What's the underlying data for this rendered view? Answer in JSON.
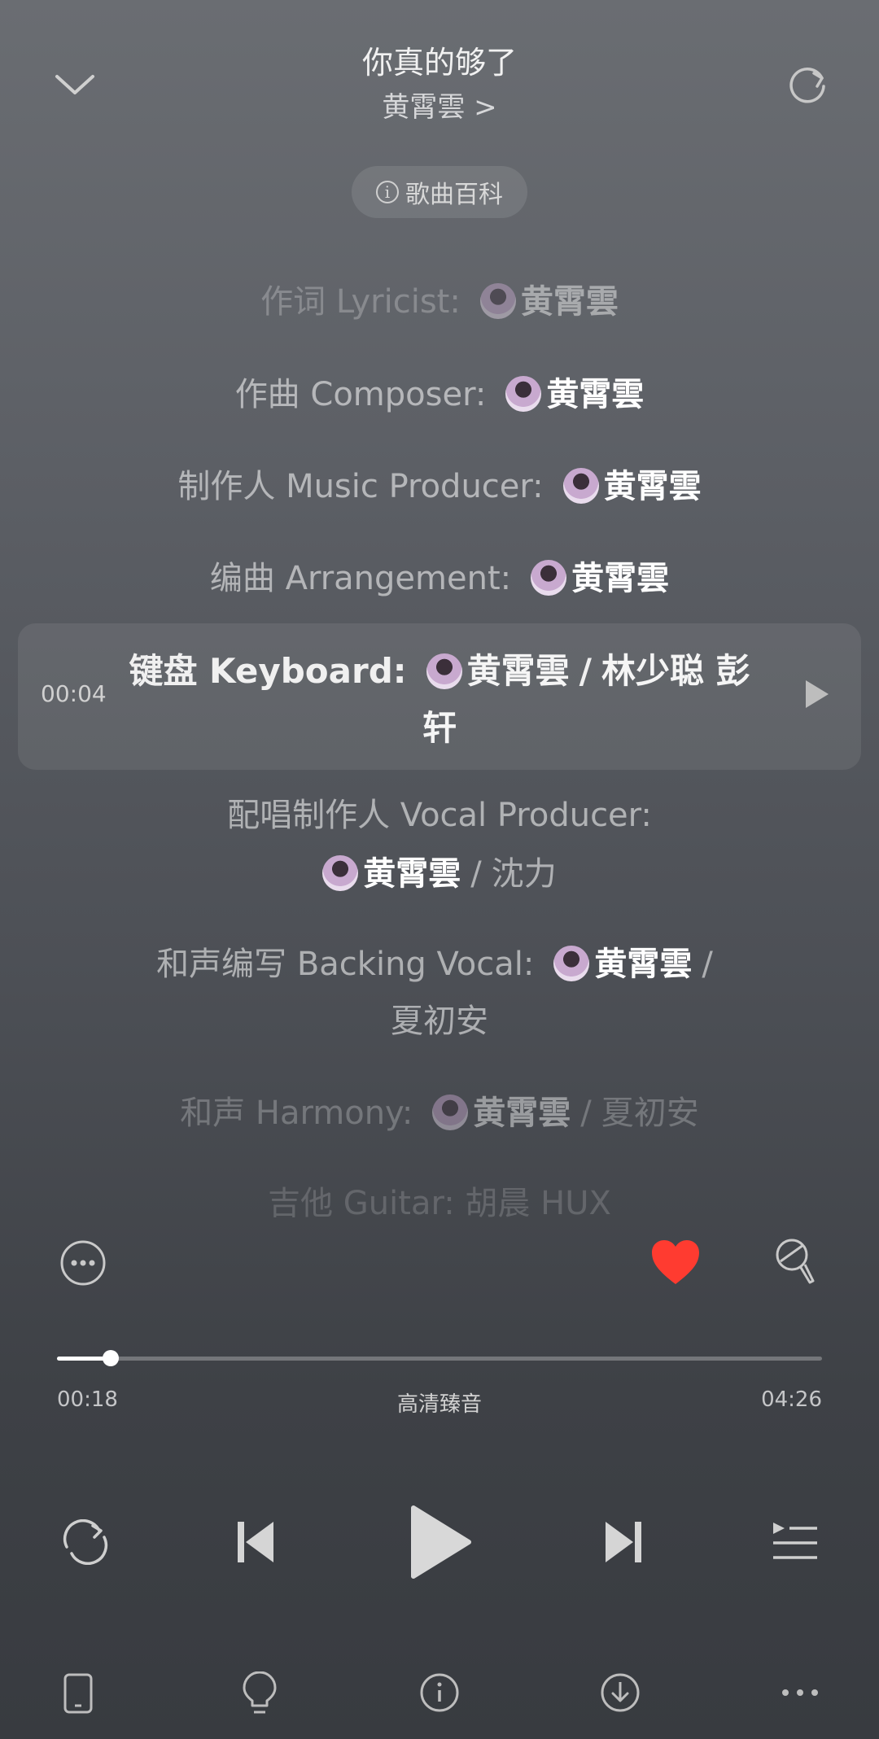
{
  "header": {
    "title": "你真的够了",
    "artist": "黄霄雲 >",
    "wiki_label": "歌曲百科",
    "icons": {
      "collapse": "chevron-down-icon",
      "refresh": "refresh-icon"
    }
  },
  "credits": [
    {
      "role": "作词 Lyricist:",
      "main": "黄霄雲",
      "others": ""
    },
    {
      "role": "作曲 Composer:",
      "main": "黄霄雲",
      "others": ""
    },
    {
      "role": "制作人 Music Producer:",
      "main": "黄霄雲",
      "others": ""
    },
    {
      "role": "编曲 Arrangement:",
      "main": "黄霄雲",
      "others": ""
    },
    {
      "role": "键盘 Keyboard:",
      "main": "黄霄雲",
      "sep": "/",
      "others": "林少聪 彭",
      "wrap": "轩",
      "time": "00:04"
    },
    {
      "role": "配唱制作人 Vocal Producer:",
      "main": "黄霄雲",
      "sep": "/",
      "others": "沈力"
    },
    {
      "role": "和声编写 Backing Vocal:",
      "main": "黄霄雲",
      "sep": "/",
      "others": "夏初安"
    },
    {
      "role": "和声 Harmony:",
      "main": "黄霄雲",
      "sep": "/",
      "others": "夏初安"
    },
    {
      "role": "吉他 Guitar:",
      "main": "",
      "others": "胡晨 HUX"
    }
  ],
  "player": {
    "current_time": "00:18",
    "total_time": "04:26",
    "quality": "高清臻音",
    "progress": 0.07,
    "liked": true,
    "accent_like": "#ff3b30"
  },
  "icons": {
    "more": "more-circle-icon",
    "like": "heart-icon",
    "karaoke": "microphone-icon",
    "repeat": "repeat-icon",
    "prev": "skip-previous-icon",
    "play": "play-icon",
    "next": "skip-next-icon",
    "queue": "playlist-icon",
    "device": "phone-device-icon",
    "tips": "lightbulb-icon",
    "info": "info-icon",
    "download": "download-icon",
    "overflow": "ellipsis-icon"
  }
}
